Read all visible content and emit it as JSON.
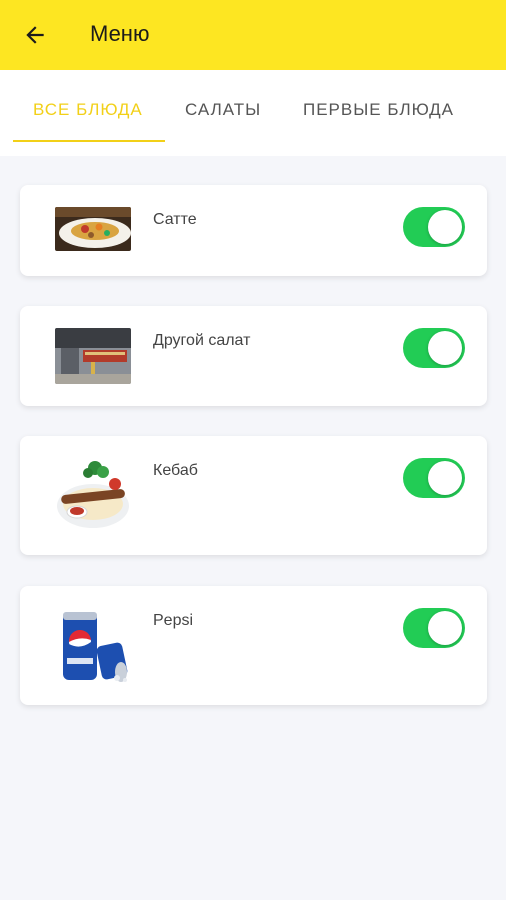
{
  "header": {
    "title": "Меню",
    "back_icon": "arrow-left-icon",
    "background": "#fde622"
  },
  "tabs": [
    {
      "label": "ВСЕ БЛЮДА",
      "active": true
    },
    {
      "label": "САЛАТЫ",
      "active": false
    },
    {
      "label": "ПЕРВЫЕ БЛЮДА",
      "active": false
    }
  ],
  "accent_color": "#f2d018",
  "toggle_on_color": "#22cc55",
  "items": [
    {
      "name": "Сатте",
      "enabled": true
    },
    {
      "name": "Другой салат",
      "enabled": true
    },
    {
      "name": "Кебаб",
      "enabled": true
    },
    {
      "name": "Pepsi",
      "enabled": true
    }
  ]
}
